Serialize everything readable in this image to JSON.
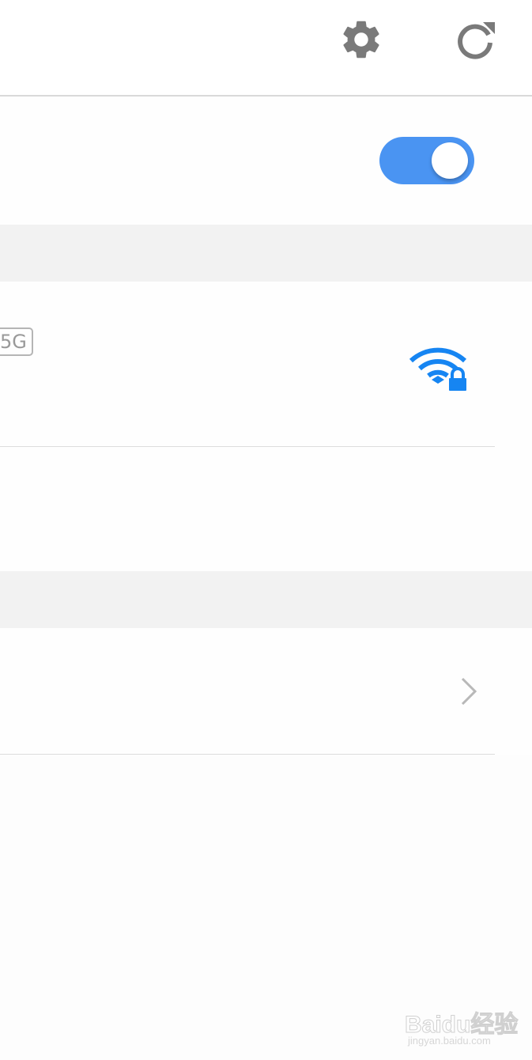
{
  "topbar": {
    "settings_icon": "gear-icon",
    "refresh_icon": "refresh-icon",
    "icon_color": "#7a7a7a",
    "divider_color": "#d9d9d9"
  },
  "wlan_toggle": {
    "state": "on",
    "accent_color": "#4a94f2"
  },
  "networks": [
    {
      "band_badge": "5G",
      "signal_icon": "wifi-lock-icon",
      "signal_color": "#1685f2",
      "secured": true
    }
  ],
  "more_row": {
    "icon": "chevron-right-icon"
  },
  "watermark": {
    "logo_text": "Baidu经验",
    "url_text": "jingyan.baidu.com"
  }
}
